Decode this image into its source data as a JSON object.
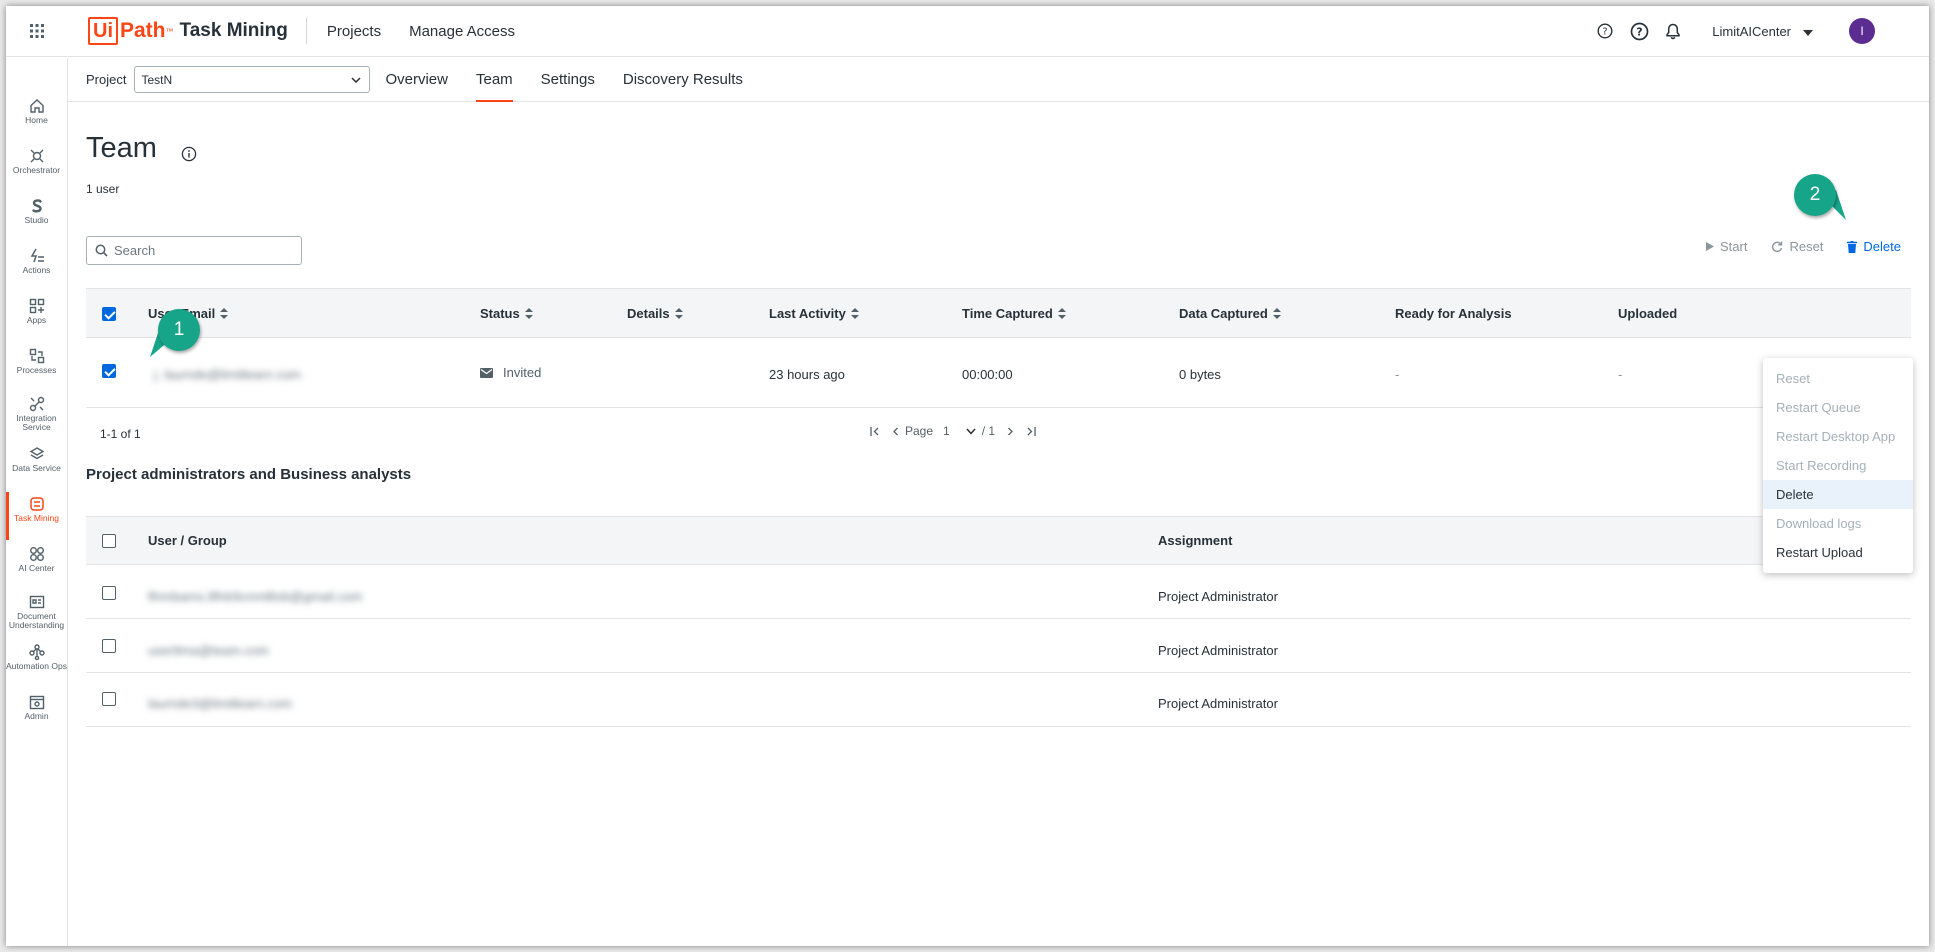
{
  "header": {
    "logo_ui": "Ui",
    "logo_path": "Path",
    "logo_tm": "™",
    "product": "Task Mining",
    "nav": [
      "Projects",
      "Manage Access"
    ],
    "account": "LimitAICenter",
    "avatar_initial": "I"
  },
  "rail": [
    {
      "label": "Home",
      "icon": "home-icon"
    },
    {
      "label": "Orchestrator",
      "icon": "orchestrator-icon"
    },
    {
      "label": "Studio",
      "icon": "studio-icon"
    },
    {
      "label": "Actions",
      "icon": "actions-icon"
    },
    {
      "label": "Apps",
      "icon": "apps-icon"
    },
    {
      "label": "Processes",
      "icon": "processes-icon"
    },
    {
      "label": "Integration Service",
      "icon": "integration-icon"
    },
    {
      "label": "Data Service",
      "icon": "data-service-icon"
    },
    {
      "label": "Task Mining",
      "icon": "task-mining-icon",
      "active": true
    },
    {
      "label": "AI Center",
      "icon": "ai-center-icon"
    },
    {
      "label": "Document Understanding",
      "icon": "document-icon"
    },
    {
      "label": "Automation Ops",
      "icon": "automation-ops-icon"
    },
    {
      "label": "Admin",
      "icon": "admin-icon"
    }
  ],
  "subnav": {
    "project_label": "Project",
    "project_value": "TestN",
    "tabs": [
      "Overview",
      "Team",
      "Settings",
      "Discovery Results"
    ],
    "active_tab": "Team"
  },
  "page": {
    "title": "Team",
    "user_count": "1 user",
    "search_placeholder": "Search"
  },
  "actions": {
    "start": "Start",
    "reset": "Reset",
    "delete": "Delete"
  },
  "team_table": {
    "columns": [
      "User Email",
      "Status",
      "Details",
      "Last Activity",
      "Time Captured",
      "Data Captured",
      "Ready for Analysis",
      "Uploaded"
    ],
    "rows": [
      {
        "email": "j.  laurnde@limitlearn.com",
        "status": "Invited",
        "details": "",
        "last_activity": "23 hours ago",
        "time_captured": "00:00:00",
        "data_captured": "0 bytes",
        "ready": "-",
        "uploaded": "-",
        "selected": true
      }
    ],
    "range": "1-1 of 1",
    "page_label": "Page",
    "page_value": "1",
    "page_total": "/ 1"
  },
  "admins": {
    "title": "Project administrators and Business analysts",
    "columns": [
      "User / Group",
      "Assignment"
    ],
    "rows": [
      {
        "user": "lfmnbams.8fnk9cmnt8ob@gmail.com",
        "assignment": "Project Administrator"
      },
      {
        "user": "user9ma@team.com",
        "assignment": "Project Administrator"
      },
      {
        "user": "laurnde3@limitlearn.com",
        "assignment": "Project Administrator"
      }
    ]
  },
  "context_menu": {
    "items": [
      {
        "label": "Reset",
        "enabled": false
      },
      {
        "label": "Restart Queue",
        "enabled": false
      },
      {
        "label": "Restart Desktop App",
        "enabled": false
      },
      {
        "label": "Start Recording",
        "enabled": false
      },
      {
        "label": "Delete",
        "enabled": true,
        "highlighted": true
      },
      {
        "label": "Download logs",
        "enabled": false
      },
      {
        "label": "Restart Upload",
        "enabled": true
      }
    ]
  },
  "callouts": [
    "1",
    "2"
  ],
  "colors": {
    "brand": "#fa4616",
    "accent": "#0067df",
    "callout": "#17a589",
    "avatar": "#5c2d91"
  }
}
